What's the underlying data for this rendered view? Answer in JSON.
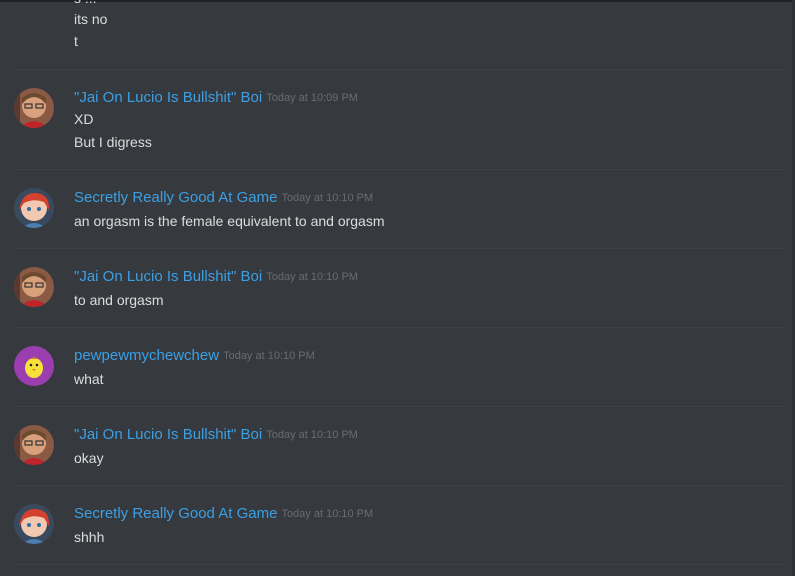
{
  "continuation": {
    "partial_line": "s ...",
    "lines": [
      "its no",
      "t"
    ]
  },
  "messages": [
    {
      "author": "\"Jai On Lucio Is Bullshit\" Boi",
      "timestamp": "Today at 10:09 PM",
      "avatar": "avatar-brown-hair-icon",
      "lines": [
        "XD",
        "But I digress"
      ]
    },
    {
      "author": "Secretly Really Good At Game",
      "timestamp": "Today at 10:10 PM",
      "avatar": "avatar-red-hair-icon",
      "lines": [
        "an orgasm is the female equivalent to and orgasm"
      ]
    },
    {
      "author": "\"Jai On Lucio Is Bullshit\" Boi",
      "timestamp": "Today at 10:10 PM",
      "avatar": "avatar-brown-hair-icon",
      "lines": [
        "to and orgasm"
      ]
    },
    {
      "author": "pewpewmychewchew",
      "timestamp": "Today at 10:10 PM",
      "avatar": "avatar-purple-chick-icon",
      "lines": [
        "what"
      ]
    },
    {
      "author": "\"Jai On Lucio Is Bullshit\" Boi",
      "timestamp": "Today at 10:10 PM",
      "avatar": "avatar-brown-hair-icon",
      "lines": [
        "okay"
      ]
    },
    {
      "author": "Secretly Really Good At Game",
      "timestamp": "Today at 10:10 PM",
      "avatar": "avatar-red-hair-icon",
      "lines": [
        "shhh"
      ]
    }
  ],
  "colors": {
    "background": "#36393e",
    "username": "#3ba0e5",
    "text": "#dcddde",
    "timestamp": "#696c71"
  }
}
